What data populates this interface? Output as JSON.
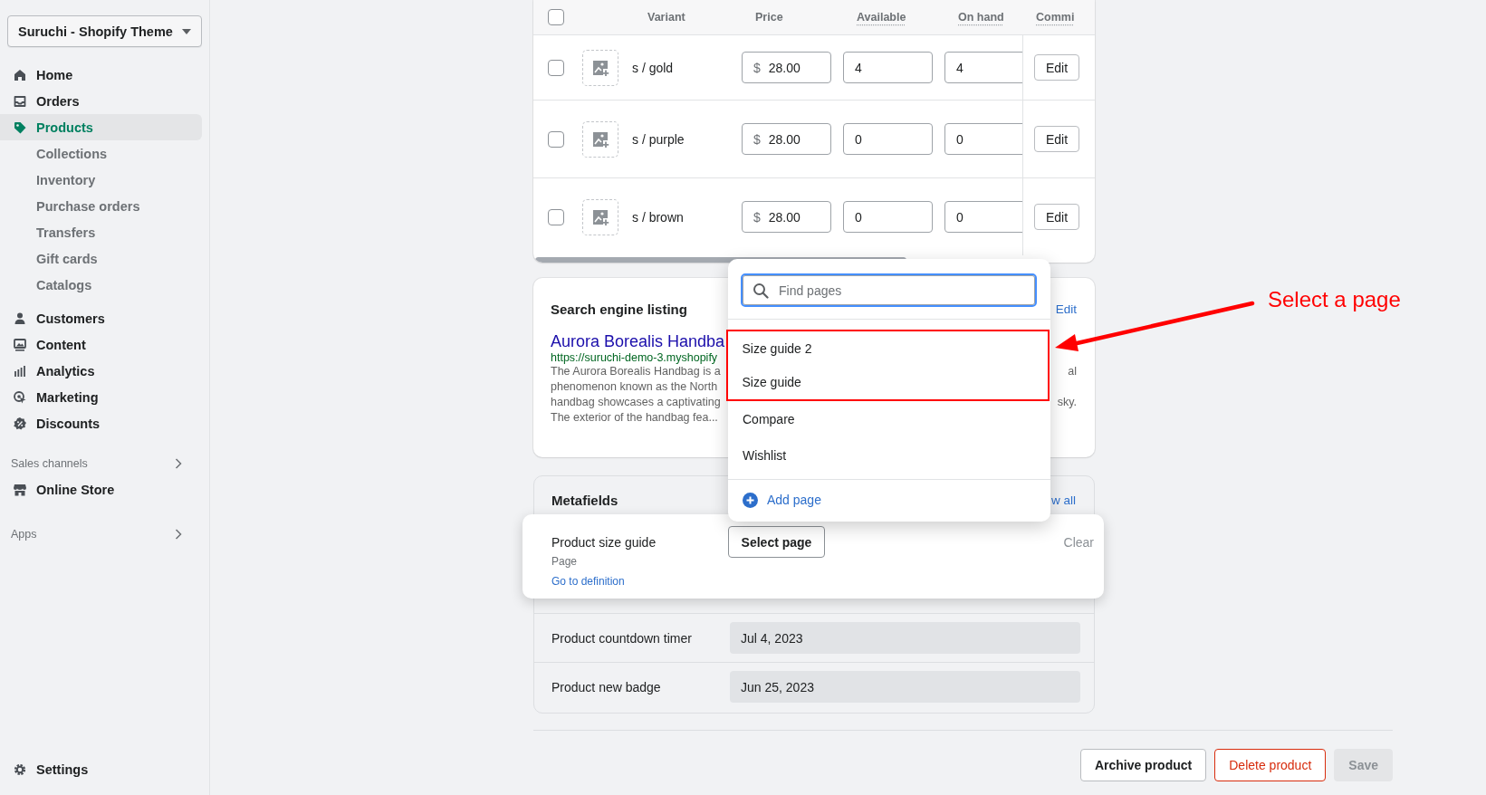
{
  "store_switcher": {
    "label": "Suruchi - Shopify Theme"
  },
  "nav_groups": [
    [
      {
        "label": "Home",
        "selected": false
      },
      {
        "label": "Orders",
        "selected": false
      },
      {
        "label": "Products",
        "selected": true,
        "children": [
          {
            "label": "Collections",
            "selected": false
          },
          {
            "label": "Inventory",
            "selected": false
          },
          {
            "label": "Purchase orders",
            "selected": false
          },
          {
            "label": "Transfers",
            "selected": false
          },
          {
            "label": "Gift cards",
            "selected": false
          },
          {
            "label": "Catalogs",
            "selected": false
          }
        ]
      }
    ],
    [
      {
        "label": "Customers",
        "selected": false
      },
      {
        "label": "Content",
        "selected": false
      },
      {
        "label": "Analytics",
        "selected": false
      },
      {
        "label": "Marketing",
        "selected": false
      },
      {
        "label": "Discounts",
        "selected": false
      }
    ]
  ],
  "sales_channels": {
    "label": "Sales channels",
    "items": [
      {
        "label": "Online Store",
        "selected": false
      }
    ]
  },
  "apps": {
    "label": "Apps"
  },
  "settings": {
    "label": "Settings"
  },
  "variants": {
    "header_checked": false,
    "columns": [
      "Variant",
      "Price",
      "Available",
      "On hand",
      "Commi"
    ],
    "rows": [
      {
        "checked": false,
        "name": "s / gold",
        "currency": "$",
        "price": "28.00",
        "available": "4",
        "on_hand": "4",
        "action": "Edit"
      },
      {
        "checked": false,
        "name": "s / purple",
        "currency": "$",
        "price": "28.00",
        "available": "0",
        "on_hand": "0",
        "action": "Edit"
      },
      {
        "checked": false,
        "name": "s / brown",
        "currency": "$",
        "price": "28.00",
        "available": "0",
        "on_hand": "0",
        "action": "Edit"
      }
    ]
  },
  "search_listing": {
    "title": "Search engine listing",
    "action": "Edit",
    "page_title": "Aurora Borealis Handba",
    "url": "https://suruchi-demo-3.myshopify",
    "description": [
      {
        "left": "The Aurora Borealis Handbag is a",
        "right": "al"
      },
      {
        "left": "phenomenon known as the North"
      },
      {
        "left": "handbag showcases a captivating",
        "right": "sky."
      },
      {
        "left": "The exterior of the handbag fea..."
      }
    ]
  },
  "metafields": {
    "title": "Metafields",
    "action": "w all",
    "active_field": {
      "label": "Product size guide",
      "type": "Page",
      "link": "Go to definition",
      "button": "Select page",
      "clear": "Clear"
    },
    "fields": [
      {
        "label": "Product countdown timer",
        "value": "Jul 4, 2023"
      },
      {
        "label": "Product new badge",
        "value": "Jun 25, 2023"
      }
    ]
  },
  "page_picker": {
    "search_placeholder": "Find pages",
    "options": [
      {
        "label": "Size guide 2",
        "highlighted": true
      },
      {
        "label": "Size guide",
        "highlighted": true
      },
      {
        "label": "Compare",
        "highlighted": false
      },
      {
        "label": "Wishlist",
        "highlighted": false
      }
    ],
    "add_label": "Add page"
  },
  "annotation": {
    "text": "Select a page"
  },
  "footer_buttons": [
    {
      "label": "Archive product",
      "kind": "secondary",
      "disabled": false
    },
    {
      "label": "Delete product",
      "kind": "destructive",
      "disabled": false
    },
    {
      "label": "Save",
      "kind": "primary",
      "disabled": true
    }
  ]
}
